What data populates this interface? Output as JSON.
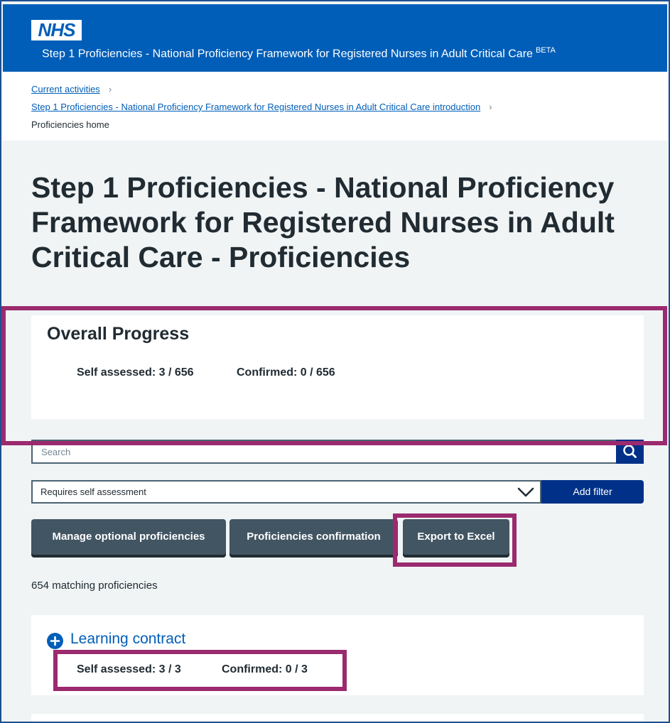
{
  "header": {
    "logo_text": "NHS",
    "service_name": "Step 1 Proficiencies - National Proficiency Framework for Registered Nurses in Adult Critical Care",
    "beta_label": "BETA",
    "brand_color": "#005eb8"
  },
  "breadcrumbs": {
    "items": [
      {
        "label": "Current activities"
      },
      {
        "label": "Step 1 Proficiencies - National Proficiency Framework for Registered Nurses in Adult Critical Care introduction"
      },
      {
        "label": "Proficiencies home"
      }
    ],
    "separator": "›"
  },
  "page": {
    "title": "Step 1 Proficiencies - National Proficiency Framework for Registered Nurses in Adult Critical Care - Proficiencies"
  },
  "overall_progress": {
    "heading": "Overall Progress",
    "self_assessed": "Self assessed: 3 / 656",
    "confirmed": "Confirmed: 0 / 656"
  },
  "search": {
    "placeholder": "Search",
    "icon": "search-icon"
  },
  "filter": {
    "selected": "Requires self assessment",
    "add_label": "Add filter",
    "icon": "chevron-down-icon"
  },
  "actions": {
    "manage_optional": "Manage optional proficiencies",
    "confirmation": "Proficiencies confirmation",
    "export": "Export to Excel"
  },
  "results": {
    "matching": "654 matching proficiencies"
  },
  "groups": [
    {
      "title": "Learning contract",
      "self_assessed": "Self assessed: 3 / 3",
      "confirmed": "Confirmed: 0 / 3",
      "icon": "plus-circle-icon"
    }
  ],
  "colors": {
    "highlight": "#9b2a6e",
    "dark_blue": "#003087",
    "button_grey": "#425563"
  }
}
